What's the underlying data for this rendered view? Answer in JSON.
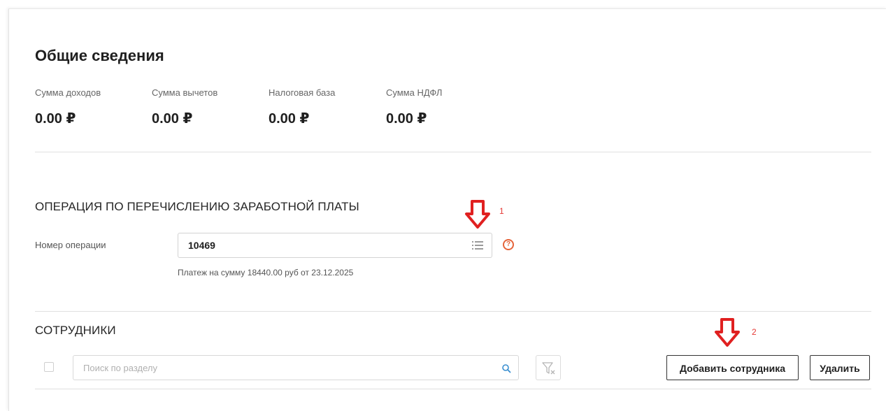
{
  "general": {
    "title": "Общие сведения",
    "stats": [
      {
        "label": "Сумма доходов",
        "value": "0.00 ₽"
      },
      {
        "label": "Сумма вычетов",
        "value": "0.00 ₽"
      },
      {
        "label": "Налоговая база",
        "value": "0.00 ₽"
      },
      {
        "label": "Сумма НДФЛ",
        "value": "0.00 ₽"
      }
    ]
  },
  "operation": {
    "heading": "ОПЕРАЦИЯ ПО ПЕРЕЧИСЛЕНИЮ ЗАРАБОТНОЙ ПЛАТЫ",
    "field_label": "Номер операции",
    "field_value": "10469",
    "hint": "Платеж на сумму 18440.00 руб от 23.12.2025",
    "help_symbol": "?",
    "list_icon": "list-icon",
    "help_icon": "question-circle-icon"
  },
  "employees": {
    "heading": "СОТРУДНИКИ",
    "search_placeholder": "Поиск по разделу",
    "search_value": "",
    "search_icon": "search-icon",
    "filter_icon": "filter-clear-icon",
    "add_button": "Добавить сотрудника",
    "delete_button": "Удалить"
  },
  "annotations": {
    "marker1": "1",
    "marker2": "2",
    "arrow_icon": "down-arrow-icon",
    "arrow_color": "#e02020"
  },
  "colors": {
    "accent": "#e5643a",
    "search_icon": "#3a8fd0",
    "annotation": "#e02020"
  }
}
